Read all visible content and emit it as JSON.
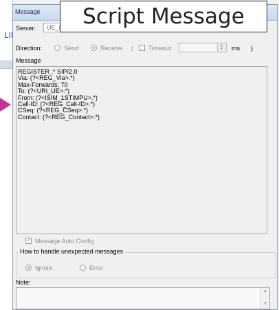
{
  "background": {
    "partial_text": "LIN"
  },
  "dialog": {
    "title_partial": "Message",
    "callout_title": "Script Message"
  },
  "server": {
    "label": "Server:",
    "value": "UE_I"
  },
  "direction": {
    "label": "Direction:",
    "send_label": "Send",
    "receive_label": "Receive",
    "open_paren": "(",
    "timeout_label": "Timeout:",
    "ms_label": "ms",
    "close_paren": ")",
    "selected": "Receive"
  },
  "message": {
    "label": "Message",
    "lines": [
      "REGISTER .* SIP/2.0",
      "Via: (?<REG_Via>.*)",
      "Max-Forwards: 70",
      "To: (?<URI_UE>.*)",
      "From: (?<ISIM_1STIMPU>.*)",
      "Call-ID: (?<REG_Call-ID>.*)",
      "CSeq: (?<REG_CSeq>.*)",
      "Contact: (?<REG_Contact>.*)"
    ]
  },
  "auto_config": {
    "label": "Message Auto Config",
    "checked": true
  },
  "unexpected": {
    "title": "How to handle unexpected messages",
    "ignore_label": "Ignore",
    "error_label": "Error",
    "selected": "Ignore"
  },
  "note": {
    "label": "Note:"
  },
  "colors": {
    "callout_text": "#222222",
    "background_arrow": "#c2329a",
    "background_link": "#2a3cff"
  },
  "icons": {
    "spin_up": "spin-up-icon",
    "spin_down": "spin-down-icon",
    "check": "checkmark-icon",
    "arrow": "pointer-arrow-icon"
  }
}
